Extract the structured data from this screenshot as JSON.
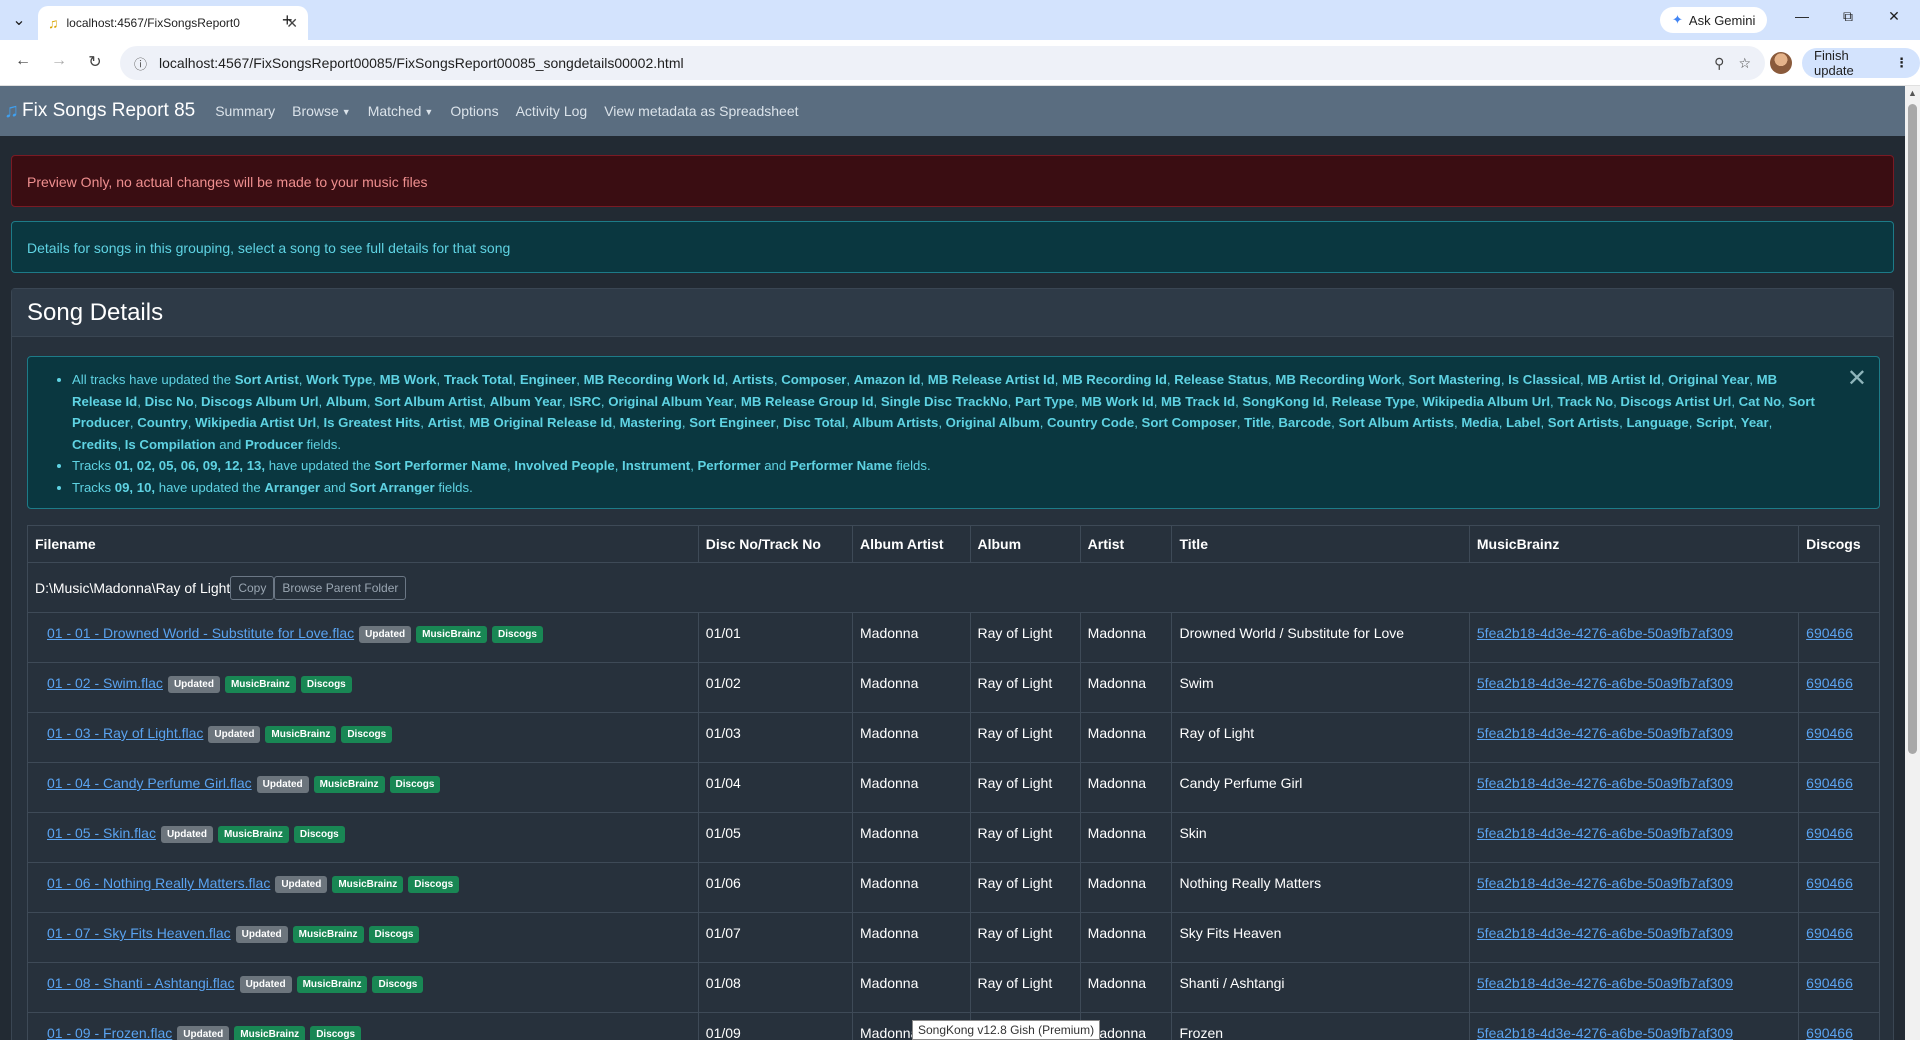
{
  "browser": {
    "tab_title": "localhost:4567/FixSongsReport0",
    "url": "localhost:4567/FixSongsReport00085/FixSongsReport00085_songdetails00002.html",
    "ask_gemini": "Ask Gemini",
    "finish_update": "Finish update"
  },
  "navbar": {
    "brand": "Fix Songs Report 85",
    "links": [
      "Summary",
      "Browse",
      "Matched",
      "Options",
      "Activity Log",
      "View metadata as Spreadsheet"
    ]
  },
  "alerts": {
    "preview": "Preview Only, no actual changes will be made to your music files",
    "details": "Details for songs in this grouping, select a song to see full details for that song"
  },
  "card": {
    "title": "Song Details"
  },
  "summary": {
    "line1_prefix": "All tracks have updated the",
    "line1_fields": [
      "Sort Artist",
      "Work Type",
      "MB Work",
      "Track Total",
      "Engineer",
      "MB Recording Work Id",
      "Artists",
      "Composer",
      "Amazon Id",
      "MB Release Artist Id",
      "MB Recording Id",
      "Release Status",
      "MB Recording Work",
      "Sort Mastering",
      "Is Classical",
      "MB Artist Id",
      "Original Year",
      "MB Release Id",
      "Disc No",
      "Discogs Album Url",
      "Album",
      "Sort Album Artist",
      "Album Year",
      "ISRC",
      "Original Album Year",
      "MB Release Group Id",
      "Single Disc TrackNo",
      "Part Type",
      "MB Work Id",
      "MB Track Id",
      "SongKong Id",
      "Release Type",
      "Wikipedia Album Url",
      "Track No",
      "Discogs Artist Url",
      "Cat No",
      "Sort Producer",
      "Country",
      "Wikipedia Artist Url",
      "Is Greatest Hits",
      "Artist",
      "MB Original Release Id",
      "Mastering",
      "Sort Engineer",
      "Disc Total",
      "Album Artists",
      "Original Album",
      "Country Code",
      "Sort Composer",
      "Title",
      "Barcode",
      "Sort Album Artists",
      "Media",
      "Label",
      "Sort Artists",
      "Language",
      "Script",
      "Year",
      "Credits",
      "Is Compilation"
    ],
    "line1_last": "Producer",
    "line2_tracks": "01, 02, 05, 06, 09, 12, 13,",
    "line2_fields": [
      "Sort Performer Name",
      "Involved People",
      "Instrument",
      "Performer"
    ],
    "line2_last": "Performer Name",
    "line3_tracks": "09, 10,",
    "line3_first": "Arranger",
    "line3_last": "Sort Arranger"
  },
  "table": {
    "headers": [
      "Filename",
      "Disc No/Track No",
      "Album Artist",
      "Album",
      "Artist",
      "Title",
      "MusicBrainz",
      "Discogs"
    ],
    "folder": "D:\\Music\\Madonna\\Ray of Light",
    "copy_label": "Copy",
    "browse_label": "Browse Parent Folder",
    "badges": [
      "Updated",
      "MusicBrainz",
      "Discogs"
    ],
    "rows": [
      {
        "file": "01 - 01 - Drowned World - Substitute for Love.flac",
        "track": "01/01",
        "album_artist": "Madonna",
        "album": "Ray of Light",
        "artist": "Madonna",
        "title": "Drowned World / Substitute for Love",
        "mb": "5fea2b18-4d3e-4276-a6be-50a9fb7af309",
        "discogs": "690466"
      },
      {
        "file": "01 - 02 - Swim.flac",
        "track": "01/02",
        "album_artist": "Madonna",
        "album": "Ray of Light",
        "artist": "Madonna",
        "title": "Swim",
        "mb": "5fea2b18-4d3e-4276-a6be-50a9fb7af309",
        "discogs": "690466"
      },
      {
        "file": "01 - 03 - Ray of Light.flac",
        "track": "01/03",
        "album_artist": "Madonna",
        "album": "Ray of Light",
        "artist": "Madonna",
        "title": "Ray of Light",
        "mb": "5fea2b18-4d3e-4276-a6be-50a9fb7af309",
        "discogs": "690466"
      },
      {
        "file": "01 - 04 - Candy Perfume Girl.flac",
        "track": "01/04",
        "album_artist": "Madonna",
        "album": "Ray of Light",
        "artist": "Madonna",
        "title": "Candy Perfume Girl",
        "mb": "5fea2b18-4d3e-4276-a6be-50a9fb7af309",
        "discogs": "690466"
      },
      {
        "file": "01 - 05 - Skin.flac",
        "track": "01/05",
        "album_artist": "Madonna",
        "album": "Ray of Light",
        "artist": "Madonna",
        "title": "Skin",
        "mb": "5fea2b18-4d3e-4276-a6be-50a9fb7af309",
        "discogs": "690466"
      },
      {
        "file": "01 - 06 - Nothing Really Matters.flac",
        "track": "01/06",
        "album_artist": "Madonna",
        "album": "Ray of Light",
        "artist": "Madonna",
        "title": "Nothing Really Matters",
        "mb": "5fea2b18-4d3e-4276-a6be-50a9fb7af309",
        "discogs": "690466"
      },
      {
        "file": "01 - 07 - Sky Fits Heaven.flac",
        "track": "01/07",
        "album_artist": "Madonna",
        "album": "Ray of Light",
        "artist": "Madonna",
        "title": "Sky Fits Heaven",
        "mb": "5fea2b18-4d3e-4276-a6be-50a9fb7af309",
        "discogs": "690466"
      },
      {
        "file": "01 - 08 - Shanti - Ashtangi.flac",
        "track": "01/08",
        "album_artist": "Madonna",
        "album": "Ray of Light",
        "artist": "Madonna",
        "title": "Shanti / Ashtangi",
        "mb": "5fea2b18-4d3e-4276-a6be-50a9fb7af309",
        "discogs": "690466"
      },
      {
        "file": "01 - 09 - Frozen.flac",
        "track": "01/09",
        "album_artist": "Madonna",
        "album": "Ray of Light",
        "artist": "Madonna",
        "title": "Frozen",
        "mb": "5fea2b18-4d3e-4276-a6be-50a9fb7af309",
        "discogs": "690466"
      }
    ]
  },
  "tooltip": "SongKong v12.8 Gish (Premium)"
}
